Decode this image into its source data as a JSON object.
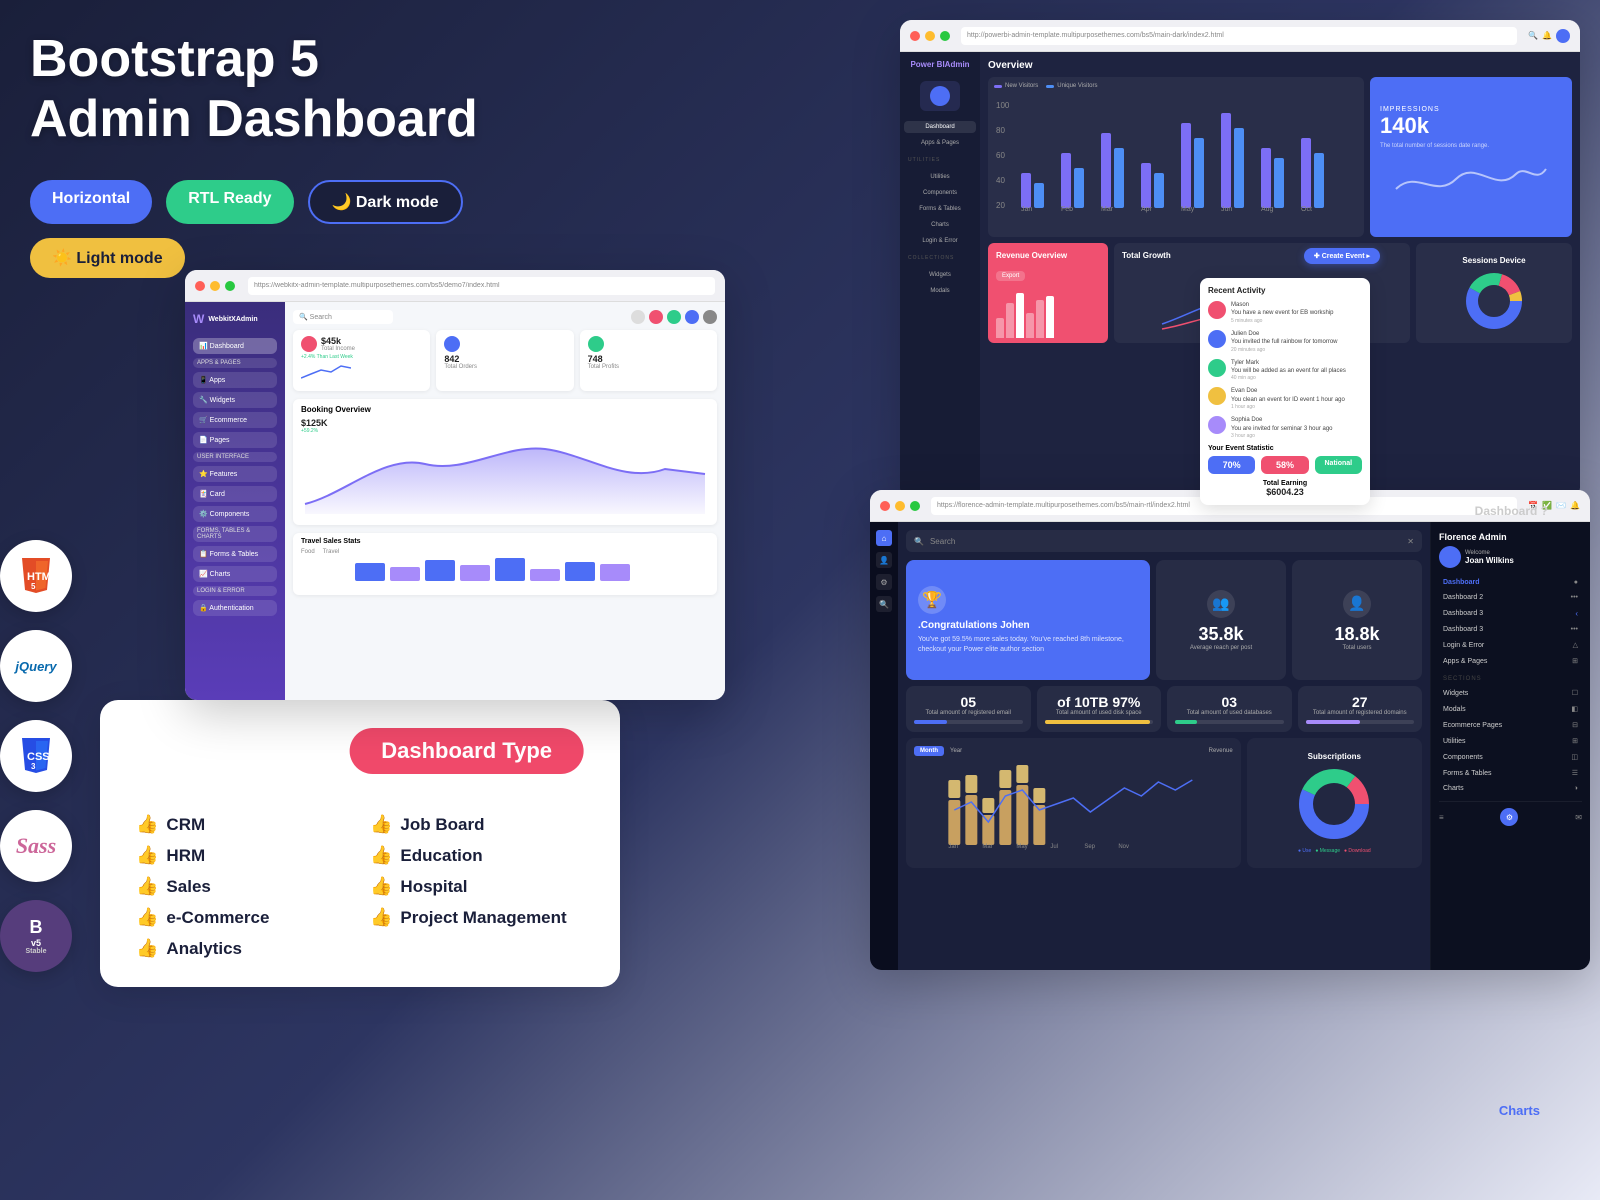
{
  "page": {
    "title": "Bootstrap 5 Admin Dashboard"
  },
  "header": {
    "line1": "Bootstrap 5",
    "line2": "Admin Dashboard"
  },
  "badges": [
    {
      "id": "horizontal",
      "label": "Horizontal",
      "class": "badge-horizontal"
    },
    {
      "id": "rtl",
      "label": "RTL Ready",
      "class": "badge-rtl"
    },
    {
      "id": "dark",
      "label": "Dark mode",
      "class": "badge-dark",
      "icon": "🌙"
    },
    {
      "id": "light",
      "label": "Light mode",
      "class": "badge-light",
      "icon": "☀️"
    }
  ],
  "tech_logos": [
    {
      "id": "html5",
      "label": "HTML",
      "sub": "5"
    },
    {
      "id": "jquery",
      "label": "jQuery"
    },
    {
      "id": "css3",
      "label": "CSS",
      "sub": "3"
    },
    {
      "id": "sass",
      "label": "Sass"
    },
    {
      "id": "bootstrap",
      "label": "B",
      "sub": "v5",
      "extra": "Stable"
    }
  ],
  "dashboard_type": {
    "title": "Dashboard Type",
    "items_col1": [
      {
        "id": "crm",
        "label": "CRM"
      },
      {
        "id": "hrm",
        "label": "HRM"
      },
      {
        "id": "sales",
        "label": "Sales"
      },
      {
        "id": "ecommerce",
        "label": "e-Commerce"
      },
      {
        "id": "analytics",
        "label": "Analytics"
      }
    ],
    "items_col2": [
      {
        "id": "jobboard",
        "label": "Job Board"
      },
      {
        "id": "education",
        "label": "Education"
      },
      {
        "id": "hospital",
        "label": "Hospital"
      },
      {
        "id": "projectmgmt",
        "label": "Project Management"
      }
    ]
  },
  "webkitx_browser": {
    "title": "WebkitX Admin",
    "url": "https://webkitx-admin-template.multipurposethemes.com/bs5/demo7/index.html",
    "sidebar_logo": "WebkitXAdmin",
    "sidebar_items": [
      "Dashboard",
      "Apps",
      "Widgets",
      "Ecommerce",
      "Pages",
      "Features",
      "Card",
      "Components",
      "Forms & Tables",
      "Charts",
      "Authentication"
    ],
    "stats": [
      {
        "label": "$45k",
        "sub": "Total Income",
        "badge": "+2.4% Than Last Week"
      },
      {
        "label": "842",
        "sub": "Total Orders"
      },
      {
        "label": "748",
        "sub": "Total Profits"
      }
    ],
    "booking": {
      "title": "Booking Overview",
      "amount": "$125K"
    }
  },
  "powerbi_browser": {
    "title": "Powerbi Admin",
    "url": "http://powerbi-admin-template.multipurposethemes.com/bs5/main-dark/index2.html",
    "sidebar_logo": "Power BIAdmin",
    "nav_items": [
      "Dashboard",
      "Apps & Pages",
      "Utilities",
      "Components",
      "Forms & Tables",
      "Charts",
      "Login & Error",
      "Widgets",
      "Modals"
    ],
    "overview_title": "Overview",
    "impressions": {
      "label": "IMPRESSIONS",
      "value": "140k",
      "sub": "The total number of sessions date range."
    },
    "revenue_title": "Revenue Overview",
    "total_growth_title": "Total Growth",
    "sessions_title": "Sessions Device"
  },
  "florence_browser": {
    "title": "Florence Admin",
    "url": "https://florence-admin-template.multipurposethemes.com/bs5/main-rtl/index2.html",
    "sidebar_title": "Florence Admin",
    "welcome": "Welcome",
    "user": "Joan Wilkins",
    "nav_items": [
      "Dashboard",
      "Dashboard 2",
      "Dashboard 3",
      "Login & Error",
      "Apps & Pages"
    ],
    "sections": [
      "SECTIONS",
      "Widgets",
      "Modals",
      "Ecommerce Pages",
      "Utilities",
      "Components",
      "Forms & Tables",
      "Charts"
    ],
    "congrats": {
      "title": ".Congratulations Johen",
      "sub": "You've got 59.5% more sales today. You've reached 8th milestone, checkout your Power elite author section"
    },
    "reach": {
      "value": "35.8k",
      "label": "Average reach per post"
    },
    "total_users": {
      "value": "18.8k",
      "label": "Total users"
    },
    "stats": [
      {
        "value": "05",
        "label": "Total amount of registered email"
      },
      {
        "value": "of 10TB 97%",
        "label": "Total amount of used disk space"
      },
      {
        "value": "03",
        "label": "Total amount of used databases"
      },
      {
        "value": "27",
        "label": "Total amount of registered domains"
      }
    ],
    "subscriptions_label": "Subscriptions",
    "charts_label": "Charts"
  },
  "colors": {
    "primary": "#4d6ef5",
    "danger": "#f05070",
    "success": "#2ecc8a",
    "warning": "#f0c040",
    "dark_bg": "#1a1f3a",
    "sidebar_purple": "#3a2d7c",
    "accent": "#a78bfa"
  }
}
